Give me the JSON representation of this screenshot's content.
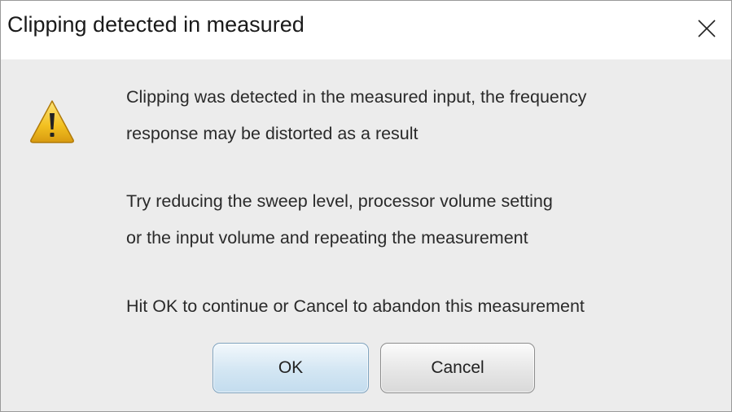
{
  "dialog": {
    "title": "Clipping detected in measured",
    "icon": "warning-icon",
    "close_icon": "close-icon",
    "message_lines": [
      "Clipping was detected in the measured input, the frequency",
      "response may be distorted as a result",
      "Try reducing the sweep level, processor volume setting",
      "or the input volume and repeating the measurement",
      "Hit OK to continue or Cancel to abandon this measurement"
    ],
    "buttons": {
      "ok_label": "OK",
      "cancel_label": "Cancel"
    }
  },
  "colors": {
    "dialog_bg": "#ececec",
    "titlebar_bg": "#ffffff",
    "warning_yellow": "#f2c020",
    "ok_button_bg": "#d3e6f3",
    "ok_button_border": "#7fa3bf"
  }
}
